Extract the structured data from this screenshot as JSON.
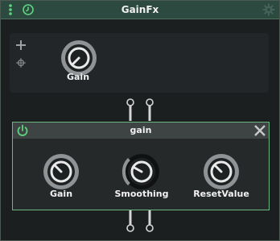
{
  "window": {
    "title": "GainFx"
  },
  "top_panel": {
    "knob": {
      "label": "Gain"
    }
  },
  "node": {
    "title": "gain",
    "knobs": [
      {
        "label": "Gain",
        "style": "gray"
      },
      {
        "label": "Smoothing",
        "style": "dark"
      },
      {
        "label": "ResetValue",
        "style": "gray"
      }
    ]
  },
  "colors": {
    "titlebar": "#2d4a40",
    "node_border": "#6ab784",
    "power_icon": "#5fd47e",
    "knob_ring": "#9a9ea0"
  },
  "icons": [
    "menu-dots-icon",
    "history-icon",
    "gear-icon",
    "plus-icon",
    "crosshair-icon",
    "power-icon",
    "close-icon",
    "connector-pin-icon"
  ]
}
